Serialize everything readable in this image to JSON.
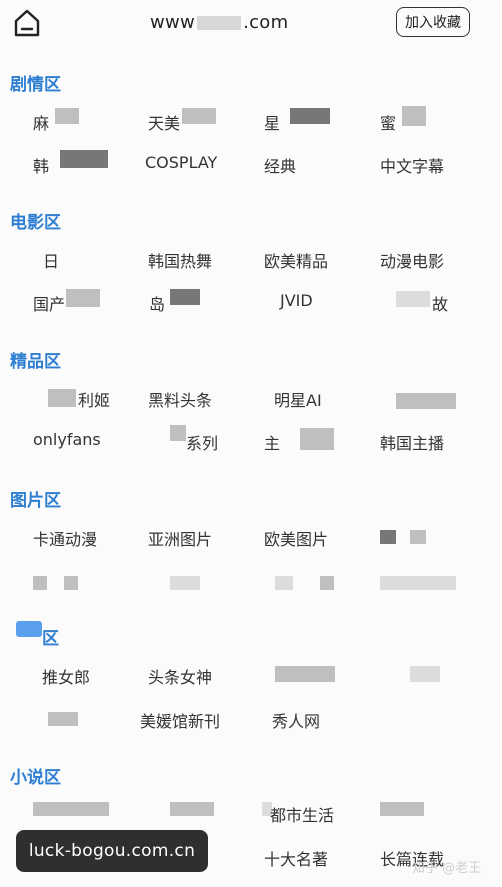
{
  "header": {
    "site_title_prefix": "www",
    "site_title_suffix": ".com",
    "bookmark_label": "加入收藏"
  },
  "sections": [
    {
      "title": "剧情区",
      "items": [
        "麻",
        "天美",
        "星",
        "蜜",
        "韩",
        "COSPLAY",
        "经典",
        "中文字幕"
      ]
    },
    {
      "title": "电影区",
      "items": [
        "日",
        "韩国热舞",
        "欧美精品",
        "动漫电影",
        "国产",
        "岛",
        "JVID",
        "故"
      ]
    },
    {
      "title": "精品区",
      "items": [
        "利姬",
        "黑料头条",
        "明星AI",
        "onlyfans",
        "系列",
        "主",
        "韩国主播"
      ]
    },
    {
      "title": "图片区",
      "items": [
        "卡通动漫",
        "亚洲图片",
        "欧美图片"
      ]
    },
    {
      "title": "区",
      "items": [
        "推女郎",
        "头条女神",
        "美媛馆新刊",
        "秀人网"
      ]
    },
    {
      "title": "小说区",
      "items": [
        "都市生活",
        "十大名著",
        "长篇连载"
      ]
    }
  ],
  "watermark": "luck-bogou.com.cn",
  "zhihu_credit": "知乎 @老王"
}
